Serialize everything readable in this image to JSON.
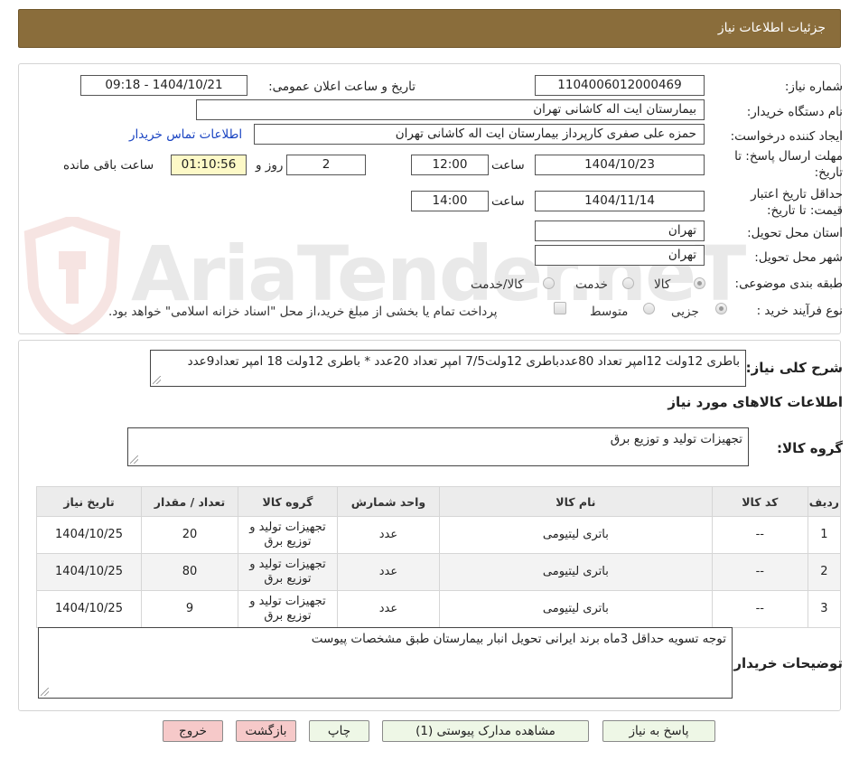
{
  "header": {
    "title": "جزئیات اطلاعات نیاز"
  },
  "watermark": {
    "text": "AriaTender.neT"
  },
  "form": {
    "need_number_label": "شماره نیاز:",
    "need_number_value": "1104006012000469",
    "announce_label": "تاریخ و ساعت اعلان عمومی:",
    "announce_value": "1404/10/21 - 09:18",
    "buyer_org_label": "نام دستگاه خریدار:",
    "buyer_org_value": "بیمارستان ایت اله کاشانی تهران",
    "requester_label": "ایجاد کننده درخواست:",
    "requester_value": "حمزه علی صفری کارپرداز بیمارستان ایت اله کاشانی تهران",
    "contact_link": "اطلاعات تماس خریدار",
    "deadline_label_1": "مهلت ارسال پاسخ: تا",
    "deadline_label_2": "تاریخ:",
    "deadline_date": "1404/10/23",
    "time_word": "ساعت",
    "deadline_time": "12:00",
    "days_value": "2",
    "days_word": "روز و",
    "remaining_time": "01:10:56",
    "remaining_word": "ساعت باقی مانده",
    "validity_label_1": "حداقل تاریخ اعتبار",
    "validity_label_2": "قیمت: تا تاریخ:",
    "validity_date": "1404/11/14",
    "validity_time": "14:00",
    "province_label": "استان محل تحویل:",
    "province_value": "تهران",
    "city_label": "شهر محل تحویل:",
    "city_value": "تهران",
    "category_label": "طبقه بندی موضوعی:",
    "category_options": [
      "کالا",
      "خدمت",
      "کالا/خدمت"
    ],
    "process_label": "نوع فرآیند خرید :",
    "process_options": [
      "جزیی",
      "متوسط"
    ],
    "process_note": "پرداخت تمام یا بخشی از مبلغ خرید،از محل \"اسناد خزانه اسلامی\" خواهد بود."
  },
  "summary": {
    "label": "شرح کلی نیاز:",
    "text": "باطری 12ولت 12امپر تعداد 80عددباطری 12ولت7/5 امپر تعداد 20عدد * باطری 12ولت 18 امپر تعداد9عدد"
  },
  "goods": {
    "section_title": "اطلاعات کالاهای مورد نیاز",
    "group_label": "گروه کالا:",
    "group_value": "تجهیزات تولید و توزیع برق",
    "columns": [
      "ردیف",
      "کد کالا",
      "نام کالا",
      "واحد شمارش",
      "گروه کالا",
      "تعداد / مقدار",
      "تاریخ نیاز"
    ],
    "rows": [
      [
        "1",
        "--",
        "باتری لیتیومی",
        "عدد",
        "تجهیزات تولید و توزیع برق",
        "20",
        "1404/10/25"
      ],
      [
        "2",
        "--",
        "باتری لیتیومی",
        "عدد",
        "تجهیزات تولید و توزیع برق",
        "80",
        "1404/10/25"
      ],
      [
        "3",
        "--",
        "باتری لیتیومی",
        "عدد",
        "تجهیزات تولید و توزیع برق",
        "9",
        "1404/10/25"
      ]
    ]
  },
  "notes": {
    "label": "توضیحات خریدار:",
    "text": "توجه تسویه حداقل 3ماه برند ایرانی تحویل انبار بیمارستان  طبق مشخصات پیوست"
  },
  "buttons": {
    "reply": "پاسخ به نیاز",
    "attachments": "مشاهده مدارک پیوستی (1)",
    "print": "چاپ",
    "back": "بازگشت",
    "exit": "خروج"
  }
}
